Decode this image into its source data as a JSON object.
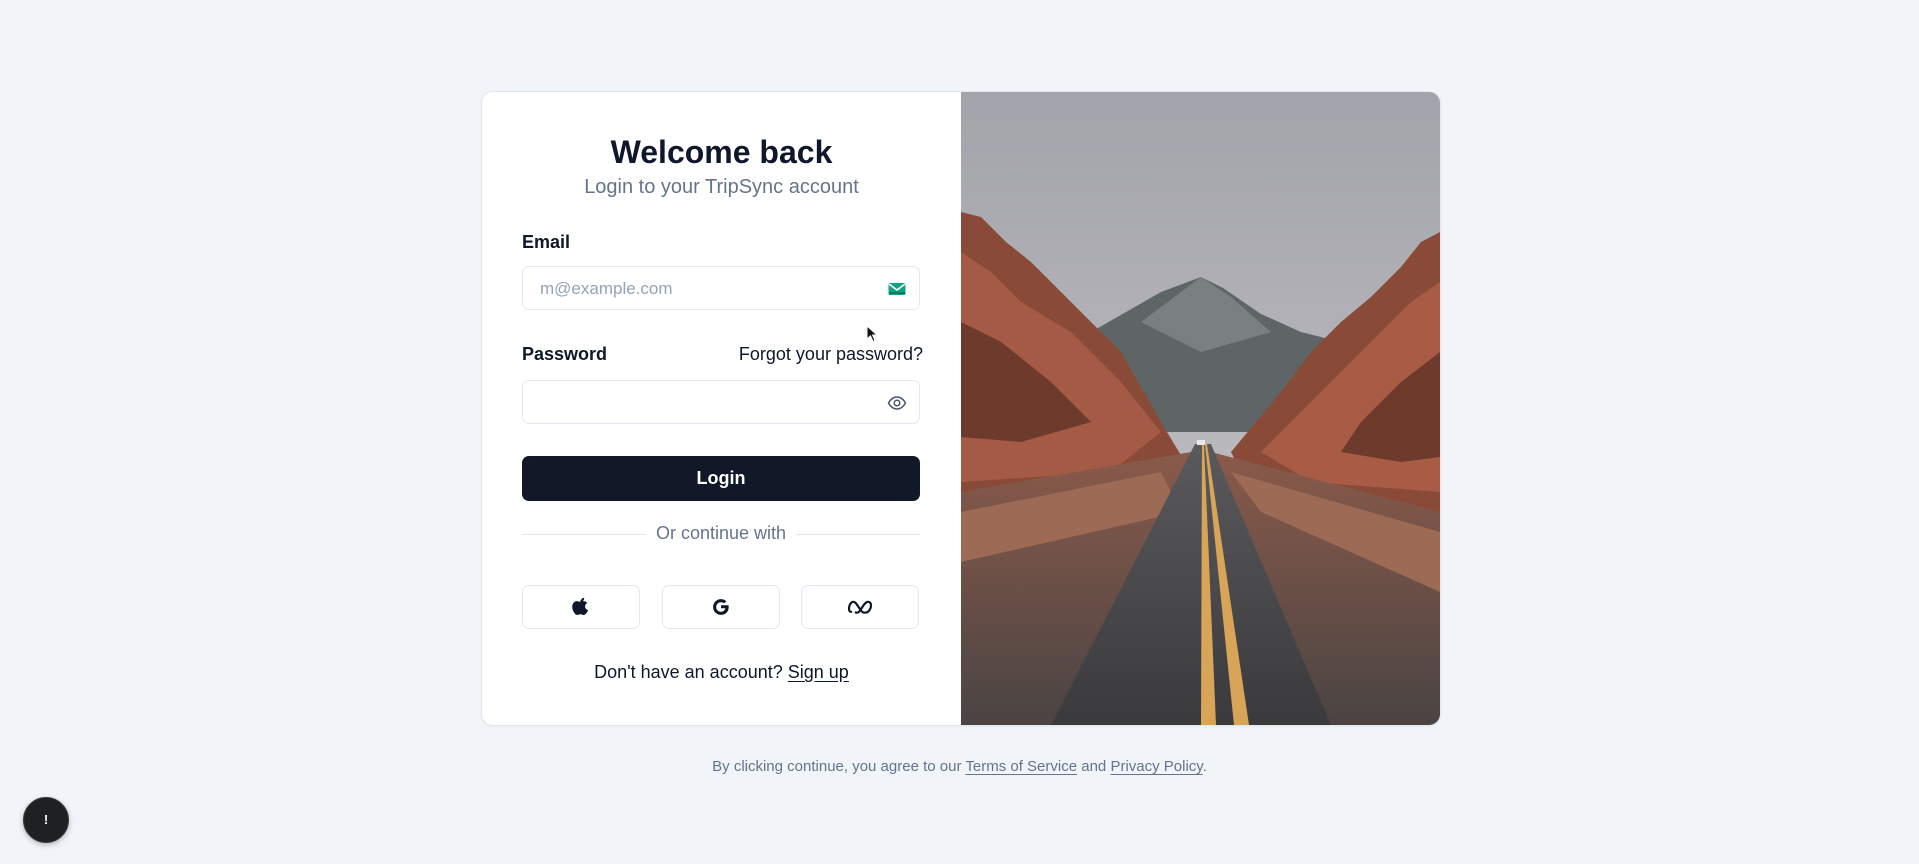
{
  "login": {
    "title": "Welcome back",
    "subtitle": "Login to your TripSync account",
    "email_label": "Email",
    "email_placeholder": "m@example.com",
    "email_value": "",
    "email_icon": "mail-icon",
    "password_label": "Password",
    "forgot_label": "Forgot your password?",
    "password_value": "",
    "password_icon": "eye-icon",
    "login_button": "Login",
    "divider_text": "Or continue with",
    "social_buttons": [
      "apple-icon",
      "google-icon",
      "meta-icon"
    ],
    "signup_prompt": "Don't have an account?",
    "signup_link": "Sign up"
  },
  "footer": {
    "prefix": "By clicking continue, you agree to our",
    "terms_link": "Terms of Service",
    "and": "and",
    "privacy_link": "Privacy Policy",
    "suffix": "."
  },
  "fab": {
    "label": "!"
  },
  "colors": {
    "page_background": "#f1f4f8",
    "primary_button": "#111827",
    "muted_text": "#64748b",
    "border": "#e2e8f0",
    "mail_icon": "#10a37f"
  }
}
